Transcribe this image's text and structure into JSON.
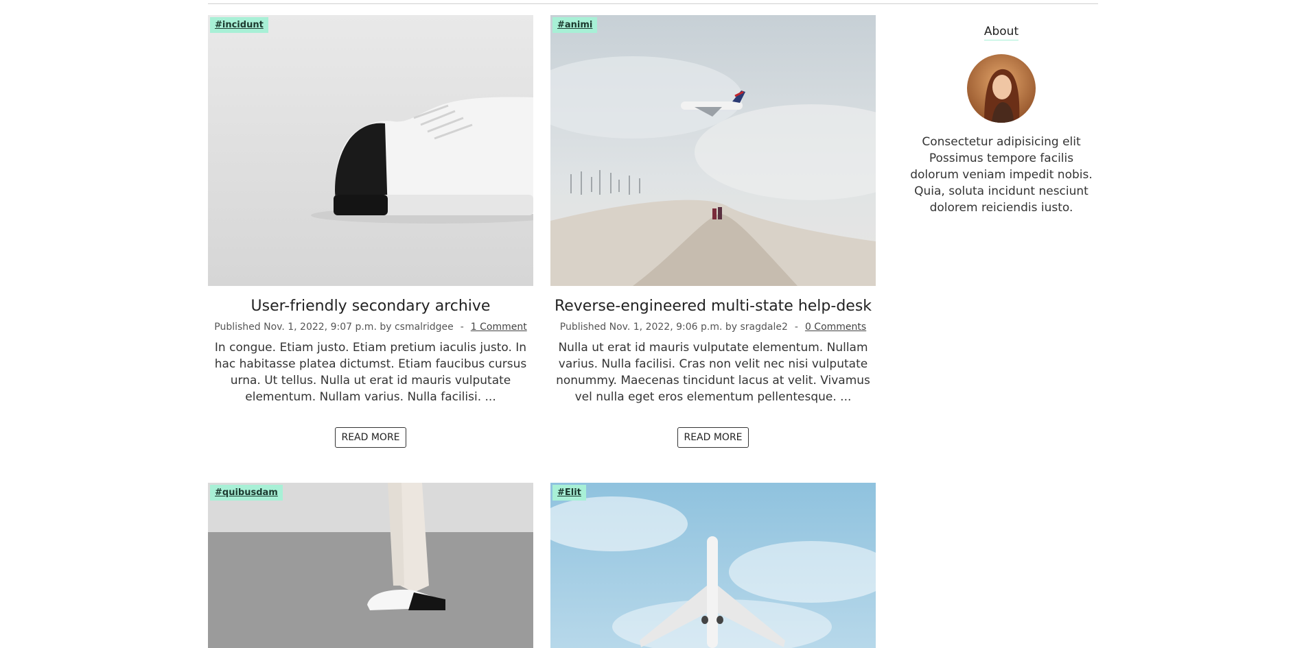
{
  "posts": [
    {
      "tag": "#incidunt",
      "title": "User-friendly secondary archive",
      "meta": "Published Nov. 1, 2022, 9:07 p.m. by csmalridgee",
      "separator": "-",
      "comments": "1 Comment",
      "excerpt": "In congue. Etiam justo. Etiam pretium iaculis justo. In hac habitasse platea dictumst. Etiam faucibus cursus urna. Ut tellus. Nulla ut erat id mauris vulputate elementum. Nullam varius. Nulla facilisi. ...",
      "read_more": "READ MORE",
      "image": "sneaker-photo"
    },
    {
      "tag": "#animi",
      "title": "Reverse-engineered multi-state help-desk",
      "meta": "Published Nov. 1, 2022, 9:06 p.m. by sragdale2",
      "separator": "-",
      "comments": "0 Comments",
      "excerpt": "Nulla ut erat id mauris vulputate elementum. Nullam varius. Nulla facilisi. Cras non velit nec nisi vulputate nonummy. Maecenas tincidunt lacus at velit. Vivamus vel nulla eget eros elementum pellentesque. ...",
      "read_more": "READ MORE",
      "image": "airplane-beach-photo"
    },
    {
      "tag": "#quibusdam",
      "image": "sneaker-legs-photo"
    },
    {
      "tag": "#Elit",
      "image": "airplane-sky-photo"
    }
  ],
  "about": {
    "title": "About",
    "avatar": "avatar-photo",
    "text": "Consectetur adipisicing elit Possimus tempore facilis dolorum veniam impedit nobis. Quia, soluta incidunt nesciunt dolorem reiciendis iusto."
  },
  "colors": {
    "tag_background": "#a8f0d6",
    "rule": "#cfcfcf"
  }
}
